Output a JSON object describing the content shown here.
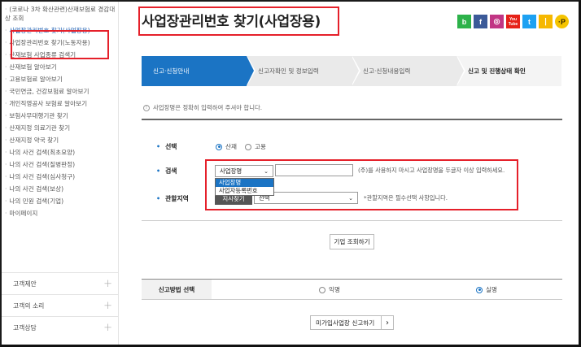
{
  "sidebar": {
    "items": [
      {
        "label": "(코로나 3차 확산관련)산재보험료 경감대상 조회"
      },
      {
        "label": "사업장관리번호 찾기(사업장용)"
      },
      {
        "label": "사업장관리번호 찾기(노동자용)"
      },
      {
        "label": "산재보험 사업종류 검색기"
      },
      {
        "label": "산재보험 알아보기"
      },
      {
        "label": "고용보험료 알아보기"
      },
      {
        "label": "국민연금, 건강보험료 알아보기"
      },
      {
        "label": "개인직영공사 보험료 알아보기"
      },
      {
        "label": "보험사무대행기관 찾기"
      },
      {
        "label": "산재지정 의료기관 찾기"
      },
      {
        "label": "산재지정 약국 찾기"
      },
      {
        "label": "나의 사건 검색(최초요양)"
      },
      {
        "label": "나의 사건 검색(질병판정)"
      },
      {
        "label": "나의 사건 검색(심사청구)"
      },
      {
        "label": "나의 사건 검색(보상)"
      },
      {
        "label": "나의 민원 검색(기업)"
      },
      {
        "label": "마이페이지"
      }
    ],
    "categories": [
      {
        "label": "고객제안"
      },
      {
        "label": "고객의 소리"
      },
      {
        "label": "고객상담"
      }
    ]
  },
  "page": {
    "title": "사업장관리번호 찾기(사업장용)"
  },
  "social": [
    "b",
    "f",
    "◎",
    "You Tube",
    "t",
    "❘",
    "·P"
  ],
  "steps": [
    {
      "label": "신고·신청안내"
    },
    {
      "label": "신고자확인 및 정보입력"
    },
    {
      "label": "신고·신청내용입력"
    },
    {
      "label": "신고 및 진행상태 확인"
    }
  ],
  "notice": "사업장명은 정확히 입력하여 주셔야 합니다.",
  "form": {
    "select_label": "선택",
    "radio_opt1": "산재",
    "radio_opt2": "고용",
    "search_label": "검색",
    "search_select_value": "사업장명",
    "search_hint": "(주)를 사용하지 마시고 사업장명을 두글자 이상 입력하세요.",
    "dropdown_options": [
      "사업장명",
      "사업자등록번호"
    ],
    "region_label": "관할지역",
    "region_button": "지사찾기",
    "region_select_value": "선택",
    "region_hint": "*관할지역은 필수선택 사항입니다.",
    "submit": "기업 조회하기"
  },
  "method": {
    "label": "신고방법 선택",
    "opt1": "익명",
    "opt2": "실명"
  },
  "bottom_button": "미가입사업장 신고하기",
  "bottom_button_arrow": "›",
  "colors": {
    "accent": "#1b74c4",
    "highlight": "#e5202a"
  }
}
